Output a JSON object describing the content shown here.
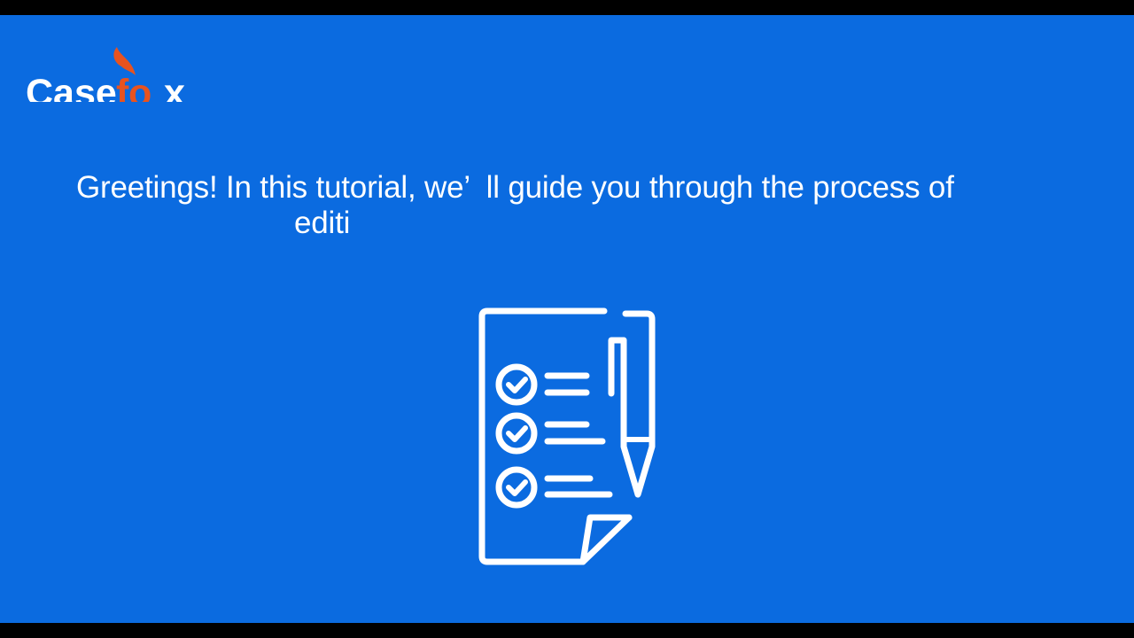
{
  "brand": {
    "logo_text": "Casefox",
    "logo_prefix": "Case",
    "logo_mid": "f",
    "logo_o": "o",
    "logo_suffix": "x",
    "accent_color": "#e8531f"
  },
  "caption": {
    "line1": "Greetings! In this tutorial, we’  ll guide you through the process of",
    "line2": "editi"
  },
  "illustration": {
    "icon": "checklist-clipboard-with-pen-icon",
    "checklist_items": 3
  },
  "colors": {
    "background": "#0b6be0",
    "letterbox": "#000000",
    "foreground": "#ffffff"
  }
}
